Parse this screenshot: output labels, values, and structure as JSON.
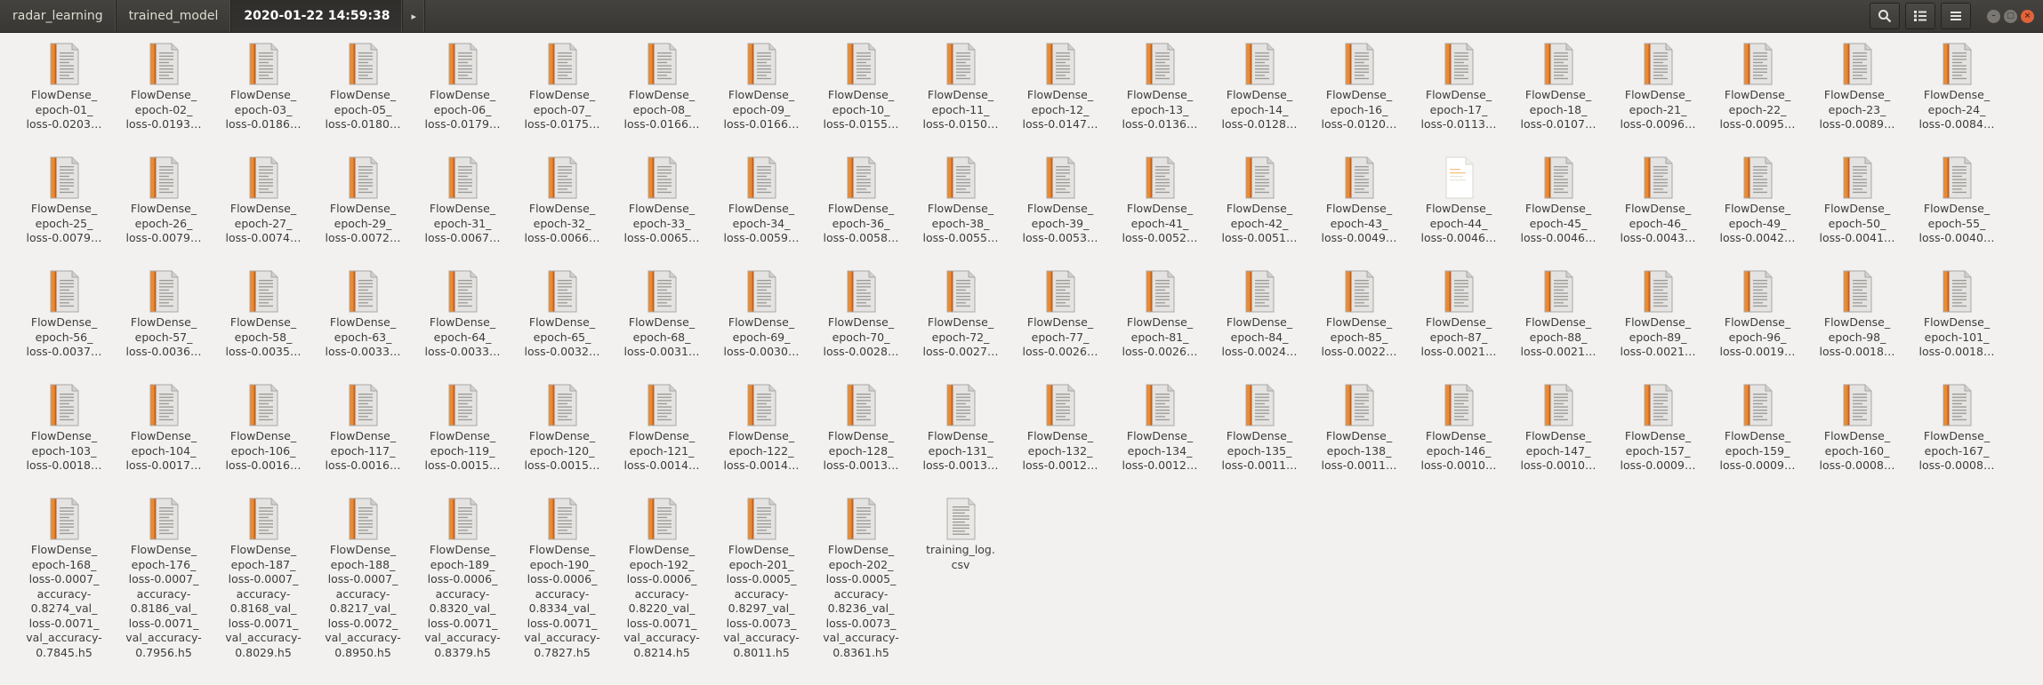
{
  "breadcrumbs": [
    {
      "label": "radar_learning"
    },
    {
      "label": "trained_model"
    },
    {
      "label": "2020-01-22 14:59:38",
      "active": true
    }
  ],
  "breadcrumb_forward_glyph": "▸",
  "toolbar": [
    {
      "icon": "search-icon"
    },
    {
      "icon": "view-options-icon"
    },
    {
      "icon": "menu-icon"
    }
  ],
  "window_controls": [
    "minimize-icon",
    "maximize-icon",
    "close-icon"
  ],
  "files": [
    {
      "name": "FlowDense_\nepoch-01_\nloss-0.0203…",
      "type": "doc"
    },
    {
      "name": "FlowDense_\nepoch-02_\nloss-0.0193…",
      "type": "doc"
    },
    {
      "name": "FlowDense_\nepoch-03_\nloss-0.0186…",
      "type": "doc"
    },
    {
      "name": "FlowDense_\nepoch-05_\nloss-0.0180…",
      "type": "doc"
    },
    {
      "name": "FlowDense_\nepoch-06_\nloss-0.0179…",
      "type": "doc"
    },
    {
      "name": "FlowDense_\nepoch-07_\nloss-0.0175…",
      "type": "doc"
    },
    {
      "name": "FlowDense_\nepoch-08_\nloss-0.0166…",
      "type": "doc"
    },
    {
      "name": "FlowDense_\nepoch-09_\nloss-0.0166…",
      "type": "doc"
    },
    {
      "name": "FlowDense_\nepoch-10_\nloss-0.0155…",
      "type": "doc"
    },
    {
      "name": "FlowDense_\nepoch-11_\nloss-0.0150…",
      "type": "doc"
    },
    {
      "name": "FlowDense_\nepoch-12_\nloss-0.0147…",
      "type": "doc"
    },
    {
      "name": "FlowDense_\nepoch-13_\nloss-0.0136…",
      "type": "doc"
    },
    {
      "name": "FlowDense_\nepoch-14_\nloss-0.0128…",
      "type": "doc"
    },
    {
      "name": "FlowDense_\nepoch-16_\nloss-0.0120…",
      "type": "doc"
    },
    {
      "name": "FlowDense_\nepoch-17_\nloss-0.0113…",
      "type": "doc"
    },
    {
      "name": "FlowDense_\nepoch-18_\nloss-0.0107…",
      "type": "doc"
    },
    {
      "name": "FlowDense_\nepoch-21_\nloss-0.0096…",
      "type": "doc"
    },
    {
      "name": "FlowDense_\nepoch-22_\nloss-0.0095…",
      "type": "doc"
    },
    {
      "name": "FlowDense_\nepoch-23_\nloss-0.0089…",
      "type": "doc"
    },
    {
      "name": "FlowDense_\nepoch-24_\nloss-0.0084…",
      "type": "doc"
    },
    {
      "name": "FlowDense_\nepoch-25_\nloss-0.0079…",
      "type": "doc"
    },
    {
      "name": "FlowDense_\nepoch-26_\nloss-0.0079…",
      "type": "doc"
    },
    {
      "name": "FlowDense_\nepoch-27_\nloss-0.0074…",
      "type": "doc"
    },
    {
      "name": "FlowDense_\nepoch-29_\nloss-0.0072…",
      "type": "doc"
    },
    {
      "name": "FlowDense_\nepoch-31_\nloss-0.0067…",
      "type": "doc"
    },
    {
      "name": "FlowDense_\nepoch-32_\nloss-0.0066…",
      "type": "doc"
    },
    {
      "name": "FlowDense_\nepoch-33_\nloss-0.0065…",
      "type": "doc"
    },
    {
      "name": "FlowDense_\nepoch-34_\nloss-0.0059…",
      "type": "doc"
    },
    {
      "name": "FlowDense_\nepoch-36_\nloss-0.0058…",
      "type": "doc"
    },
    {
      "name": "FlowDense_\nepoch-38_\nloss-0.0055…",
      "type": "doc"
    },
    {
      "name": "FlowDense_\nepoch-39_\nloss-0.0053…",
      "type": "doc"
    },
    {
      "name": "FlowDense_\nepoch-41_\nloss-0.0052…",
      "type": "doc"
    },
    {
      "name": "FlowDense_\nepoch-42_\nloss-0.0051…",
      "type": "doc"
    },
    {
      "name": "FlowDense_\nepoch-43_\nloss-0.0049…",
      "type": "doc"
    },
    {
      "name": "FlowDense_\nepoch-44_\nloss-0.0046…",
      "type": "blank"
    },
    {
      "name": "FlowDense_\nepoch-45_\nloss-0.0046…",
      "type": "doc"
    },
    {
      "name": "FlowDense_\nepoch-46_\nloss-0.0043…",
      "type": "doc"
    },
    {
      "name": "FlowDense_\nepoch-49_\nloss-0.0042…",
      "type": "doc"
    },
    {
      "name": "FlowDense_\nepoch-50_\nloss-0.0041…",
      "type": "doc"
    },
    {
      "name": "FlowDense_\nepoch-55_\nloss-0.0040…",
      "type": "doc"
    },
    {
      "name": "FlowDense_\nepoch-56_\nloss-0.0037…",
      "type": "doc"
    },
    {
      "name": "FlowDense_\nepoch-57_\nloss-0.0036…",
      "type": "doc"
    },
    {
      "name": "FlowDense_\nepoch-58_\nloss-0.0035…",
      "type": "doc"
    },
    {
      "name": "FlowDense_\nepoch-63_\nloss-0.0033…",
      "type": "doc"
    },
    {
      "name": "FlowDense_\nepoch-64_\nloss-0.0033…",
      "type": "doc"
    },
    {
      "name": "FlowDense_\nepoch-65_\nloss-0.0032…",
      "type": "doc"
    },
    {
      "name": "FlowDense_\nepoch-68_\nloss-0.0031…",
      "type": "doc"
    },
    {
      "name": "FlowDense_\nepoch-69_\nloss-0.0030…",
      "type": "doc"
    },
    {
      "name": "FlowDense_\nepoch-70_\nloss-0.0028…",
      "type": "doc"
    },
    {
      "name": "FlowDense_\nepoch-72_\nloss-0.0027…",
      "type": "doc"
    },
    {
      "name": "FlowDense_\nepoch-77_\nloss-0.0026…",
      "type": "doc"
    },
    {
      "name": "FlowDense_\nepoch-81_\nloss-0.0026…",
      "type": "doc"
    },
    {
      "name": "FlowDense_\nepoch-84_\nloss-0.0024…",
      "type": "doc"
    },
    {
      "name": "FlowDense_\nepoch-85_\nloss-0.0022…",
      "type": "doc"
    },
    {
      "name": "FlowDense_\nepoch-87_\nloss-0.0021…",
      "type": "doc"
    },
    {
      "name": "FlowDense_\nepoch-88_\nloss-0.0021…",
      "type": "doc"
    },
    {
      "name": "FlowDense_\nepoch-89_\nloss-0.0021…",
      "type": "doc"
    },
    {
      "name": "FlowDense_\nepoch-96_\nloss-0.0019…",
      "type": "doc"
    },
    {
      "name": "FlowDense_\nepoch-98_\nloss-0.0018…",
      "type": "doc"
    },
    {
      "name": "FlowDense_\nepoch-101_\nloss-0.0018…",
      "type": "doc"
    },
    {
      "name": "FlowDense_\nepoch-103_\nloss-0.0018…",
      "type": "doc"
    },
    {
      "name": "FlowDense_\nepoch-104_\nloss-0.0017…",
      "type": "doc"
    },
    {
      "name": "FlowDense_\nepoch-106_\nloss-0.0016…",
      "type": "doc"
    },
    {
      "name": "FlowDense_\nepoch-117_\nloss-0.0016…",
      "type": "doc"
    },
    {
      "name": "FlowDense_\nepoch-119_\nloss-0.0015…",
      "type": "doc"
    },
    {
      "name": "FlowDense_\nepoch-120_\nloss-0.0015…",
      "type": "doc"
    },
    {
      "name": "FlowDense_\nepoch-121_\nloss-0.0014…",
      "type": "doc"
    },
    {
      "name": "FlowDense_\nepoch-122_\nloss-0.0014…",
      "type": "doc"
    },
    {
      "name": "FlowDense_\nepoch-128_\nloss-0.0013…",
      "type": "doc"
    },
    {
      "name": "FlowDense_\nepoch-131_\nloss-0.0013…",
      "type": "doc"
    },
    {
      "name": "FlowDense_\nepoch-132_\nloss-0.0012…",
      "type": "doc"
    },
    {
      "name": "FlowDense_\nepoch-134_\nloss-0.0012…",
      "type": "doc"
    },
    {
      "name": "FlowDense_\nepoch-135_\nloss-0.0011…",
      "type": "doc"
    },
    {
      "name": "FlowDense_\nepoch-138_\nloss-0.0011…",
      "type": "doc"
    },
    {
      "name": "FlowDense_\nepoch-146_\nloss-0.0010…",
      "type": "doc"
    },
    {
      "name": "FlowDense_\nepoch-147_\nloss-0.0010…",
      "type": "doc"
    },
    {
      "name": "FlowDense_\nepoch-157_\nloss-0.0009…",
      "type": "doc"
    },
    {
      "name": "FlowDense_\nepoch-159_\nloss-0.0009…",
      "type": "doc"
    },
    {
      "name": "FlowDense_\nepoch-160_\nloss-0.0008…",
      "type": "doc"
    },
    {
      "name": "FlowDense_\nepoch-167_\nloss-0.0008…",
      "type": "doc"
    },
    {
      "name": "FlowDense_\nepoch-168_\nloss-0.0007_\naccuracy-\n0.8274_val_\nloss-0.0071_\nval_accuracy-\n0.7845.h5",
      "type": "doc"
    },
    {
      "name": "FlowDense_\nepoch-176_\nloss-0.0007_\naccuracy-\n0.8186_val_\nloss-0.0071_\nval_accuracy-\n0.7956.h5",
      "type": "doc"
    },
    {
      "name": "FlowDense_\nepoch-187_\nloss-0.0007_\naccuracy-\n0.8168_val_\nloss-0.0071_\nval_accuracy-\n0.8029.h5",
      "type": "doc"
    },
    {
      "name": "FlowDense_\nepoch-188_\nloss-0.0007_\naccuracy-\n0.8217_val_\nloss-0.0072_\nval_accuracy-\n0.8950.h5",
      "type": "doc"
    },
    {
      "name": "FlowDense_\nepoch-189_\nloss-0.0006_\naccuracy-\n0.8320_val_\nloss-0.0071_\nval_accuracy-\n0.8379.h5",
      "type": "doc"
    },
    {
      "name": "FlowDense_\nepoch-190_\nloss-0.0006_\naccuracy-\n0.8334_val_\nloss-0.0071_\nval_accuracy-\n0.7827.h5",
      "type": "doc"
    },
    {
      "name": "FlowDense_\nepoch-192_\nloss-0.0006_\naccuracy-\n0.8220_val_\nloss-0.0071_\nval_accuracy-\n0.8214.h5",
      "type": "doc"
    },
    {
      "name": "FlowDense_\nepoch-201_\nloss-0.0005_\naccuracy-\n0.8297_val_\nloss-0.0073_\nval_accuracy-\n0.8011.h5",
      "type": "doc"
    },
    {
      "name": "FlowDense_\nepoch-202_\nloss-0.0005_\naccuracy-\n0.8236_val_\nloss-0.0073_\nval_accuracy-\n0.8361.h5",
      "type": "doc"
    },
    {
      "name": "training_log.\ncsv",
      "type": "text"
    }
  ]
}
